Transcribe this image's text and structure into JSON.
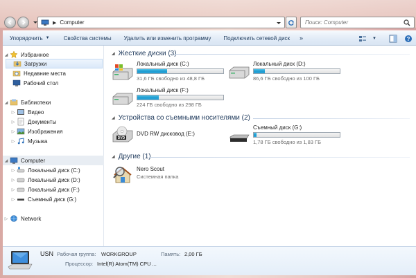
{
  "address": {
    "path": "Computer"
  },
  "search": {
    "placeholder": "Поиск: Computer"
  },
  "toolbar": {
    "organize": "Упорядочить",
    "system_props": "Свойства системы",
    "uninstall": "Удалить или изменить программу",
    "map_drive": "Подключить сетевой диск",
    "more": "»"
  },
  "sidebar": {
    "favorites": "Избранное",
    "downloads": "Загрузки",
    "recent": "Недавние места",
    "desktop": "Рабочий стол",
    "libraries": "Библиотеки",
    "video": "Видео",
    "documents": "Документы",
    "images": "Изображения",
    "music": "Музыка",
    "computer": "Computer",
    "disk_c": "Локальный диск (C:)",
    "disk_d": "Локальный диск (D:)",
    "disk_f": "Локальный диск (F:)",
    "disk_g": "Съемный диск (G:)",
    "network": "Network"
  },
  "groups": {
    "hdd": "Жесткие диски (3)",
    "removable": "Устройства со съемными носителями (2)",
    "other": "Другие (1)"
  },
  "drives": {
    "c": {
      "name": "Локальный диск (C:)",
      "free": "31,6 ГБ свободно из 48,8 ГБ",
      "used_fraction": 0.35
    },
    "d": {
      "name": "Локальный диск (D:)",
      "free": "86,6 ГБ свободно из 100 ГБ",
      "used_fraction": 0.13
    },
    "f": {
      "name": "Локальный диск (F:)",
      "free": "224 ГБ свободно из 298 ГБ",
      "used_fraction": 0.25
    },
    "e": {
      "name": "DVD RW дисковод (E:)"
    },
    "g": {
      "name": "Съемный диск (G:)",
      "free": "1,78 ГБ свободно из 1,83 ГБ",
      "used_fraction": 0.03
    }
  },
  "other": {
    "name": "Nero Scout",
    "type": "Системная папка"
  },
  "details": {
    "name": "USN",
    "workgroup_label": "Рабочая группа:",
    "workgroup_value": "WORKGROUP",
    "memory_label": "Память:",
    "memory_value": "2,00 ГБ",
    "cpu_label": "Процессор:",
    "cpu_value": "Intel(R) Atom(TM) CPU ..."
  },
  "colors": {
    "accent": "#1e395b",
    "bar_fill": "#1f9bd0"
  }
}
